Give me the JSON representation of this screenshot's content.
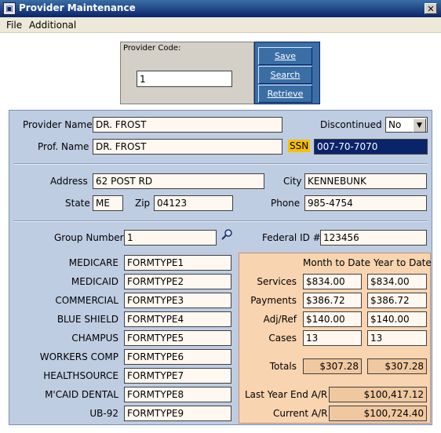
{
  "window": {
    "title": "Provider Maintenance",
    "close_label": "✕"
  },
  "menu": [
    "File",
    "Additional"
  ],
  "provider_code": {
    "label": "Provider Code:",
    "value": "1"
  },
  "buttons": {
    "save": "Save",
    "search": "Search",
    "retrieve": "Retrieve"
  },
  "provider": {
    "name_label": "Provider Name",
    "name": "DR. FROST",
    "discontinued_label": "Discontinued",
    "discontinued": "No",
    "prof_name_label": "Prof. Name",
    "prof_name": "DR. FROST",
    "ssn_label": "SSN",
    "ssn": "007-70-7070"
  },
  "address": {
    "address_label": "Address",
    "address": "62 POST RD",
    "city_label": "City",
    "city": "KENNEBUNK",
    "state_label": "State",
    "state": "ME",
    "zip_label": "Zip",
    "zip": "04123",
    "phone_label": "Phone",
    "phone": "985-4754"
  },
  "group": {
    "label": "Group Number",
    "value": "1",
    "federal_label": "Federal ID #",
    "federal_value": "123456"
  },
  "forms": [
    {
      "label": "MEDICARE",
      "value": "FORMTYPE1"
    },
    {
      "label": "MEDICAID",
      "value": "FORMTYPE2"
    },
    {
      "label": "COMMERCIAL",
      "value": "FORMTYPE3"
    },
    {
      "label": "BLUE SHIELD",
      "value": "FORMTYPE4"
    },
    {
      "label": "CHAMPUS",
      "value": "FORMTYPE5"
    },
    {
      "label": "WORKERS COMP",
      "value": "FORMTYPE6"
    },
    {
      "label": "HEALTHSOURCE",
      "value": "FORMTYPE7"
    },
    {
      "label": "M'CAID DENTAL",
      "value": "FORMTYPE8"
    },
    {
      "label": "UB-92",
      "value": "FORMTYPE9"
    }
  ],
  "stats": {
    "mtd_header": "Month to Date",
    "ytd_header": "Year to Date",
    "rows": [
      {
        "label": "Services",
        "mtd": "$834.00",
        "ytd": "$834.00"
      },
      {
        "label": "Payments",
        "mtd": "$386.72",
        "ytd": "$386.72"
      },
      {
        "label": "Adj/Ref",
        "mtd": "$140.00",
        "ytd": "$140.00"
      },
      {
        "label": "Cases",
        "mtd": "13",
        "ytd": "13"
      }
    ],
    "totals_label": "Totals",
    "totals_mtd": "$307.28",
    "totals_ytd": "$307.28",
    "last_year_label": "Last Year End A/R",
    "last_year": "$100,417.12",
    "current_label": "Current A/R",
    "current": "$100,724.40"
  }
}
